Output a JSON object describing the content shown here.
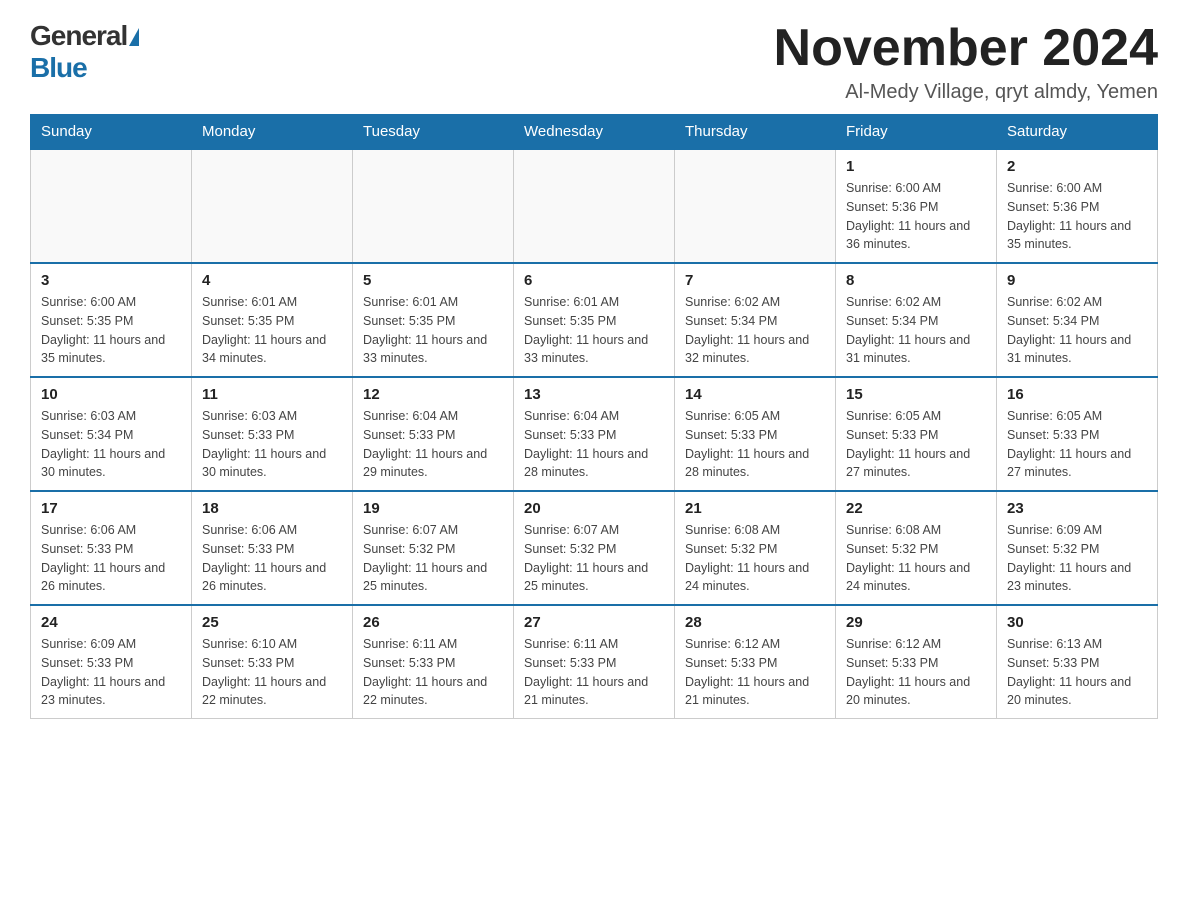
{
  "logo": {
    "general": "General",
    "blue": "Blue"
  },
  "title": "November 2024",
  "location": "Al-Medy Village, qryt almdy, Yemen",
  "days_of_week": [
    "Sunday",
    "Monday",
    "Tuesday",
    "Wednesday",
    "Thursday",
    "Friday",
    "Saturday"
  ],
  "weeks": [
    [
      {
        "day": "",
        "info": ""
      },
      {
        "day": "",
        "info": ""
      },
      {
        "day": "",
        "info": ""
      },
      {
        "day": "",
        "info": ""
      },
      {
        "day": "",
        "info": ""
      },
      {
        "day": "1",
        "info": "Sunrise: 6:00 AM\nSunset: 5:36 PM\nDaylight: 11 hours and 36 minutes."
      },
      {
        "day": "2",
        "info": "Sunrise: 6:00 AM\nSunset: 5:36 PM\nDaylight: 11 hours and 35 minutes."
      }
    ],
    [
      {
        "day": "3",
        "info": "Sunrise: 6:00 AM\nSunset: 5:35 PM\nDaylight: 11 hours and 35 minutes."
      },
      {
        "day": "4",
        "info": "Sunrise: 6:01 AM\nSunset: 5:35 PM\nDaylight: 11 hours and 34 minutes."
      },
      {
        "day": "5",
        "info": "Sunrise: 6:01 AM\nSunset: 5:35 PM\nDaylight: 11 hours and 33 minutes."
      },
      {
        "day": "6",
        "info": "Sunrise: 6:01 AM\nSunset: 5:35 PM\nDaylight: 11 hours and 33 minutes."
      },
      {
        "day": "7",
        "info": "Sunrise: 6:02 AM\nSunset: 5:34 PM\nDaylight: 11 hours and 32 minutes."
      },
      {
        "day": "8",
        "info": "Sunrise: 6:02 AM\nSunset: 5:34 PM\nDaylight: 11 hours and 31 minutes."
      },
      {
        "day": "9",
        "info": "Sunrise: 6:02 AM\nSunset: 5:34 PM\nDaylight: 11 hours and 31 minutes."
      }
    ],
    [
      {
        "day": "10",
        "info": "Sunrise: 6:03 AM\nSunset: 5:34 PM\nDaylight: 11 hours and 30 minutes."
      },
      {
        "day": "11",
        "info": "Sunrise: 6:03 AM\nSunset: 5:33 PM\nDaylight: 11 hours and 30 minutes."
      },
      {
        "day": "12",
        "info": "Sunrise: 6:04 AM\nSunset: 5:33 PM\nDaylight: 11 hours and 29 minutes."
      },
      {
        "day": "13",
        "info": "Sunrise: 6:04 AM\nSunset: 5:33 PM\nDaylight: 11 hours and 28 minutes."
      },
      {
        "day": "14",
        "info": "Sunrise: 6:05 AM\nSunset: 5:33 PM\nDaylight: 11 hours and 28 minutes."
      },
      {
        "day": "15",
        "info": "Sunrise: 6:05 AM\nSunset: 5:33 PM\nDaylight: 11 hours and 27 minutes."
      },
      {
        "day": "16",
        "info": "Sunrise: 6:05 AM\nSunset: 5:33 PM\nDaylight: 11 hours and 27 minutes."
      }
    ],
    [
      {
        "day": "17",
        "info": "Sunrise: 6:06 AM\nSunset: 5:33 PM\nDaylight: 11 hours and 26 minutes."
      },
      {
        "day": "18",
        "info": "Sunrise: 6:06 AM\nSunset: 5:33 PM\nDaylight: 11 hours and 26 minutes."
      },
      {
        "day": "19",
        "info": "Sunrise: 6:07 AM\nSunset: 5:32 PM\nDaylight: 11 hours and 25 minutes."
      },
      {
        "day": "20",
        "info": "Sunrise: 6:07 AM\nSunset: 5:32 PM\nDaylight: 11 hours and 25 minutes."
      },
      {
        "day": "21",
        "info": "Sunrise: 6:08 AM\nSunset: 5:32 PM\nDaylight: 11 hours and 24 minutes."
      },
      {
        "day": "22",
        "info": "Sunrise: 6:08 AM\nSunset: 5:32 PM\nDaylight: 11 hours and 24 minutes."
      },
      {
        "day": "23",
        "info": "Sunrise: 6:09 AM\nSunset: 5:32 PM\nDaylight: 11 hours and 23 minutes."
      }
    ],
    [
      {
        "day": "24",
        "info": "Sunrise: 6:09 AM\nSunset: 5:33 PM\nDaylight: 11 hours and 23 minutes."
      },
      {
        "day": "25",
        "info": "Sunrise: 6:10 AM\nSunset: 5:33 PM\nDaylight: 11 hours and 22 minutes."
      },
      {
        "day": "26",
        "info": "Sunrise: 6:11 AM\nSunset: 5:33 PM\nDaylight: 11 hours and 22 minutes."
      },
      {
        "day": "27",
        "info": "Sunrise: 6:11 AM\nSunset: 5:33 PM\nDaylight: 11 hours and 21 minutes."
      },
      {
        "day": "28",
        "info": "Sunrise: 6:12 AM\nSunset: 5:33 PM\nDaylight: 11 hours and 21 minutes."
      },
      {
        "day": "29",
        "info": "Sunrise: 6:12 AM\nSunset: 5:33 PM\nDaylight: 11 hours and 20 minutes."
      },
      {
        "day": "30",
        "info": "Sunrise: 6:13 AM\nSunset: 5:33 PM\nDaylight: 11 hours and 20 minutes."
      }
    ]
  ]
}
